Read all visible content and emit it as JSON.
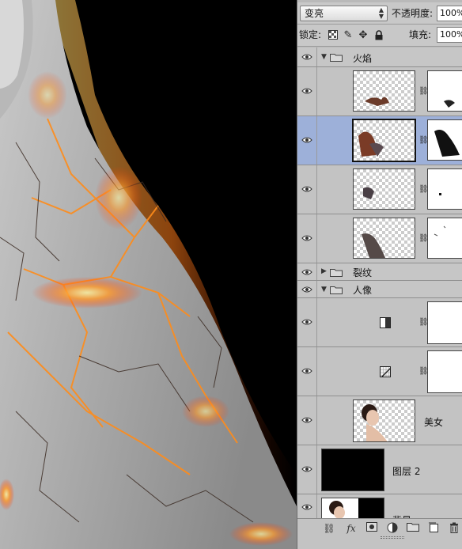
{
  "panel": {
    "blend_mode": "变亮",
    "opacity_label": "不透明度:",
    "opacity_value": "100%",
    "lock_label": "锁定:",
    "fill_label": "填充:",
    "fill_value": "100%"
  },
  "icons": {
    "lock_transparency": "checker-icon",
    "lock_pixels": "brush-icon",
    "lock_position": "move-icon",
    "lock_all": "lock-icon"
  },
  "layers": {
    "group_fire": "火焰",
    "group_crack": "裂纹",
    "group_portrait": "人像",
    "layer_beauty": "美女",
    "layer_2": "图层 2",
    "layer_bottom": "背景"
  },
  "toolbar": {
    "link": "link-icon",
    "fx": "fx",
    "mask": "mask-icon",
    "adjustment": "adjustment-icon",
    "group": "folder-icon",
    "new_layer": "new-layer-icon",
    "delete": "trash-icon"
  },
  "colors": {
    "selected_row": "#9db0d9",
    "panel_bg": "#b9b9b9"
  }
}
